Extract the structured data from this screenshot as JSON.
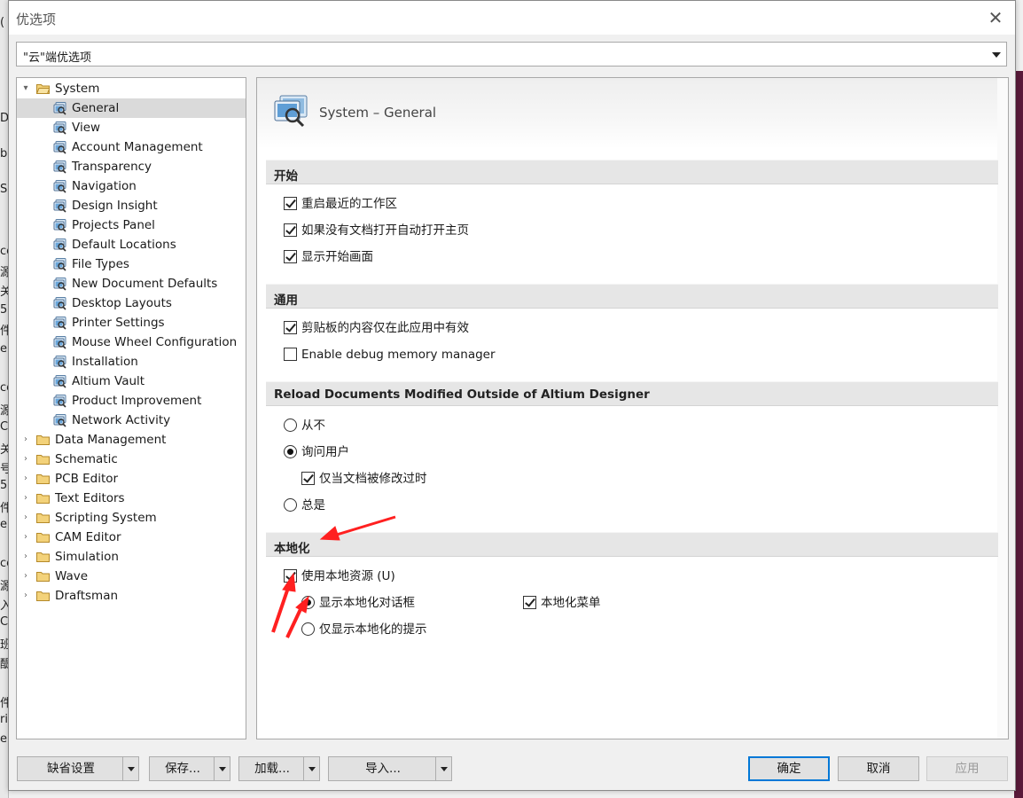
{
  "window": {
    "title": "优选项",
    "close_glyph": "✕"
  },
  "combo": {
    "value": "\"云\"端优选项"
  },
  "background_fragments": [
    "(",
    "Da",
    "b",
    "S",
    "ce",
    "源",
    "关",
    "5",
    "件",
    "era",
    "ce",
    "源",
    "CU",
    "关",
    "号",
    "5",
    "件",
    "era",
    "ce",
    "源",
    "入",
    "CU",
    "班",
    "醍",
    "件",
    "ric",
    "era"
  ],
  "tree": {
    "system": {
      "label": "System",
      "expanded": true
    },
    "system_children": [
      "General",
      "View",
      "Account Management",
      "Transparency",
      "Navigation",
      "Design Insight",
      "Projects Panel",
      "Default Locations",
      "File Types",
      "New Document Defaults",
      "Desktop Layouts",
      "Printer Settings",
      "Mouse Wheel Configuration",
      "Installation",
      "Altium Vault",
      "Product Improvement",
      "Network Activity"
    ],
    "selected": "General",
    "other_folders": [
      "Data Management",
      "Schematic",
      "PCB Editor",
      "Text Editors",
      "Scripting System",
      "CAM Editor",
      "Simulation",
      "Wave",
      "Draftsman"
    ]
  },
  "panel": {
    "title": "System – General",
    "sections": {
      "start": {
        "label": "开始",
        "options": [
          {
            "label": "重启最近的工作区",
            "checked": true
          },
          {
            "label": "如果没有文档打开自动打开主页",
            "checked": true
          },
          {
            "label": "显示开始画面",
            "checked": true
          }
        ]
      },
      "general": {
        "label": "通用",
        "options": [
          {
            "label": "剪贴板的内容仅在此应用中有效",
            "checked": true
          },
          {
            "label": "Enable debug memory manager",
            "checked": false
          }
        ]
      },
      "reload": {
        "label": "Reload Documents Modified Outside of Altium Designer",
        "never": {
          "label": "从不",
          "selected": false
        },
        "ask": {
          "label": "询问用户",
          "selected": true
        },
        "only_modified": {
          "label": "仅当文档被修改过时",
          "checked": true
        },
        "always": {
          "label": "总是",
          "selected": false
        }
      },
      "localization": {
        "label": "本地化",
        "use_local": {
          "label": "使用本地资源 (U)",
          "checked": true
        },
        "show_dialog": {
          "label": "显示本地化对话框",
          "selected": true
        },
        "show_hints": {
          "label": "仅显示本地化的提示",
          "selected": false
        },
        "local_menu": {
          "label": "本地化菜单",
          "checked": true
        }
      }
    }
  },
  "buttons": {
    "defaults": "缺省设置",
    "save": "保存...",
    "load": "加载...",
    "import": "导入...",
    "ok": "确定",
    "cancel": "取消",
    "apply": "应用"
  },
  "colors": {
    "annotation_arrow": "#ff2020",
    "primary_border": "#0078d7",
    "folder": "#e8c060"
  }
}
